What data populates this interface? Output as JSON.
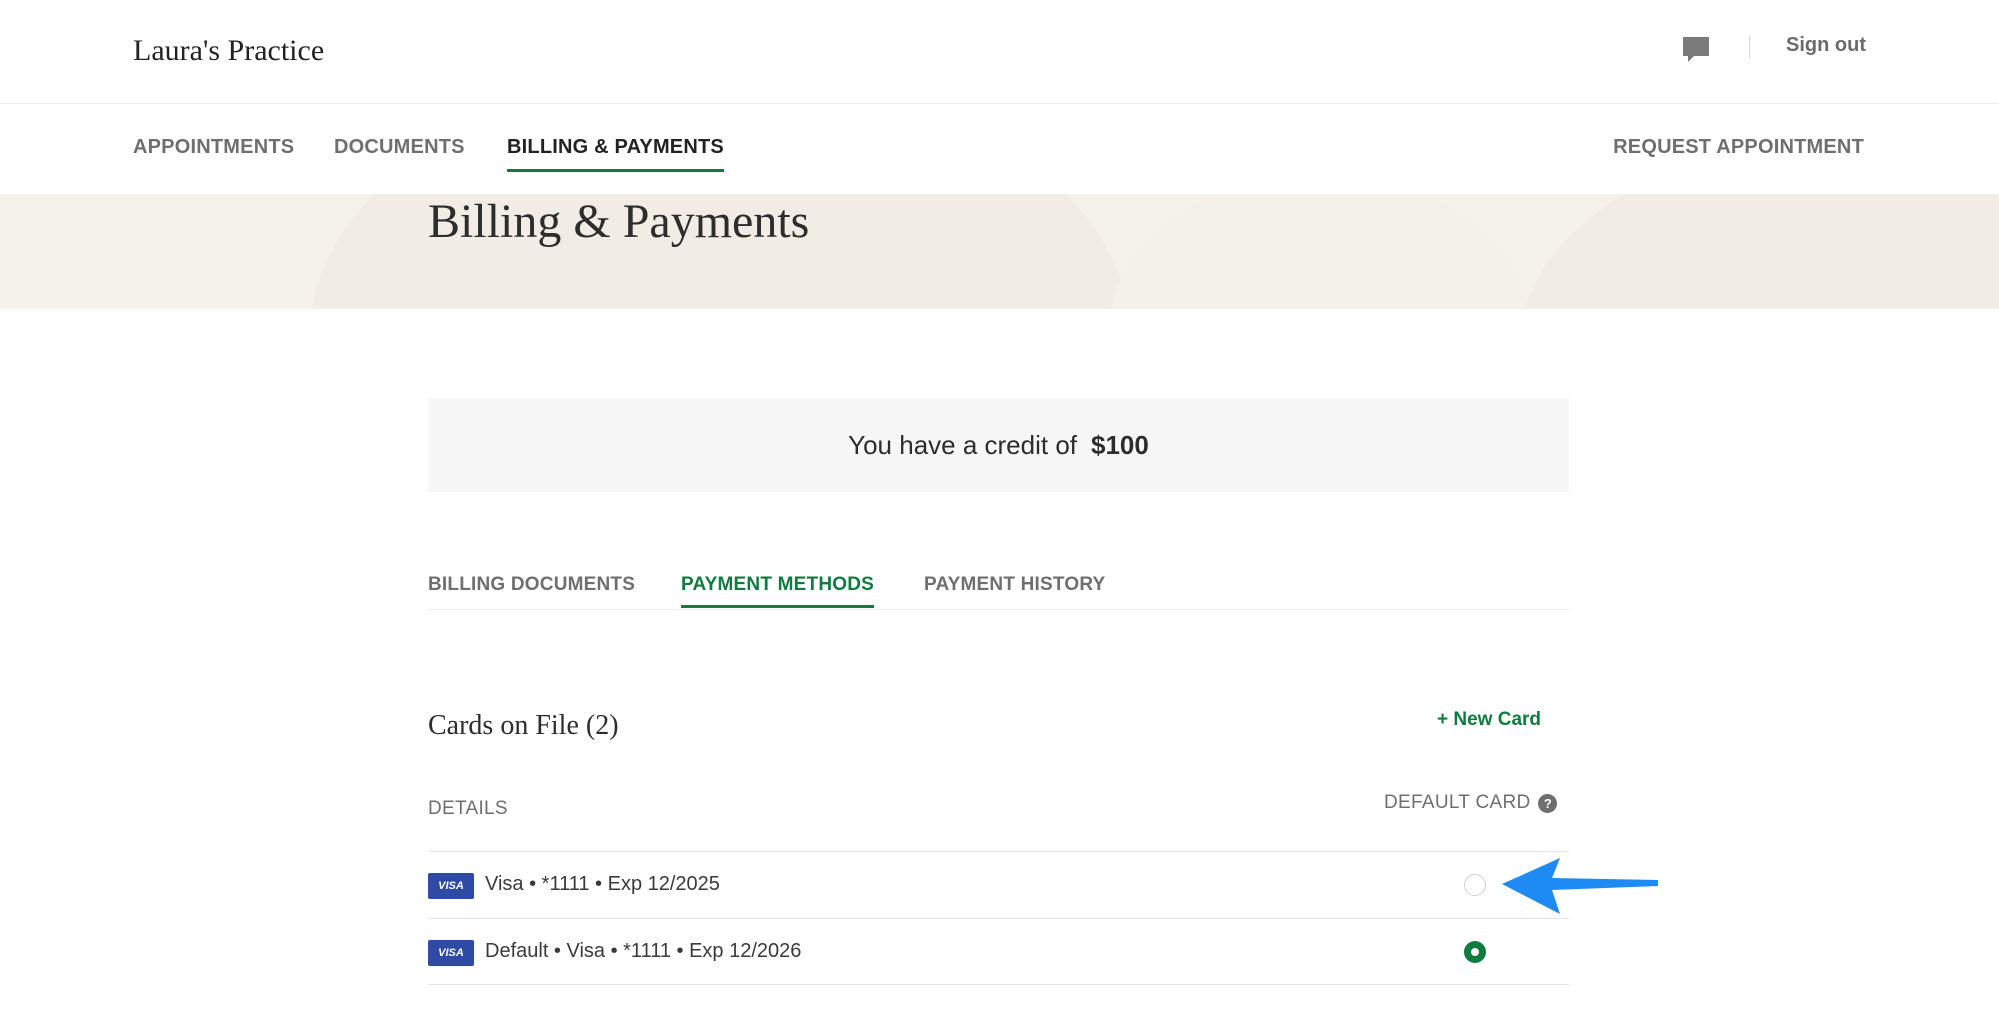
{
  "header": {
    "practice_name": "Laura's Practice",
    "sign_out": "Sign out",
    "chat_icon": "chat-bubble-icon"
  },
  "nav": {
    "items": [
      {
        "label": "APPOINTMENTS"
      },
      {
        "label": "DOCUMENTS"
      },
      {
        "label": "BILLING & PAYMENTS",
        "active": true
      }
    ],
    "request_appointment": "REQUEST APPOINTMENT"
  },
  "page": {
    "title": "Billing & Payments"
  },
  "credit": {
    "text": "You have a credit of",
    "amount": "$100"
  },
  "tabs": [
    {
      "label": "BILLING DOCUMENTS"
    },
    {
      "label": "PAYMENT METHODS",
      "active": true
    },
    {
      "label": "PAYMENT HISTORY"
    }
  ],
  "cards": {
    "title": "Cards on File (2)",
    "new_card": "+ New Card",
    "col_details": "DETAILS",
    "col_default": "DEFAULT CARD",
    "help_icon": "question-circle-icon",
    "items": [
      {
        "brand": "VISA",
        "text": "Visa • *1111 • Exp 12/2025",
        "is_default": false
      },
      {
        "brand": "VISA",
        "text": "Default • Visa • *1111 • Exp 12/2026",
        "is_default": true
      }
    ]
  },
  "colors": {
    "accent_green": "#0f7b3e",
    "visa_blue": "#2f4aa5",
    "annotation_arrow": "#1e8bf5",
    "hero_bg": "#f5f2ec"
  }
}
